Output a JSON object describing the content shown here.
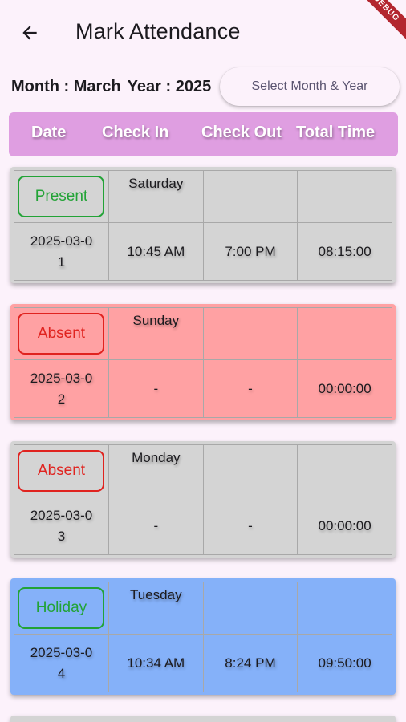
{
  "appbar": {
    "title": "Mark Attendance",
    "back_icon": "arrow-back-icon",
    "debug_banner": "DEBUG"
  },
  "filter": {
    "month_label": "Month : March",
    "year_label": "Year : 2025",
    "select_button": "Select Month & Year"
  },
  "table_header": {
    "date": "Date",
    "check_in": "Check In",
    "check_out": "Check Out",
    "total_time": "Total Time"
  },
  "records": [
    {
      "status": "Present",
      "day": "Saturday",
      "date_line1": "2025-03-0",
      "date_line2": "1",
      "check_in": "10:45 AM",
      "check_out": "7:00 PM",
      "total": "08:15:00"
    },
    {
      "status": "Absent",
      "day": "Sunday",
      "date_line1": "2025-03-0",
      "date_line2": "2",
      "check_in": "-",
      "check_out": "-",
      "total": "00:00:00"
    },
    {
      "status": "Absent",
      "day": "Monday",
      "date_line1": "2025-03-0",
      "date_line2": "3",
      "check_in": "-",
      "check_out": "-",
      "total": "00:00:00"
    },
    {
      "status": "Holiday",
      "day": "Tuesday",
      "date_line1": "2025-03-0",
      "date_line2": "4",
      "check_in": "10:34 AM",
      "check_out": "8:24 PM",
      "total": "09:50:00"
    }
  ],
  "colors": {
    "background": "#fcf2fb",
    "header_bar": "#df9ee1",
    "present_card": "#d4d4d4",
    "absent_red_card": "#ffa1a3",
    "absent_grey_card": "#d4d4d4",
    "holiday_card": "#85b1f9",
    "present_chip": "#22a336",
    "absent_chip": "#e0231f",
    "holiday_chip": "#22a336"
  }
}
